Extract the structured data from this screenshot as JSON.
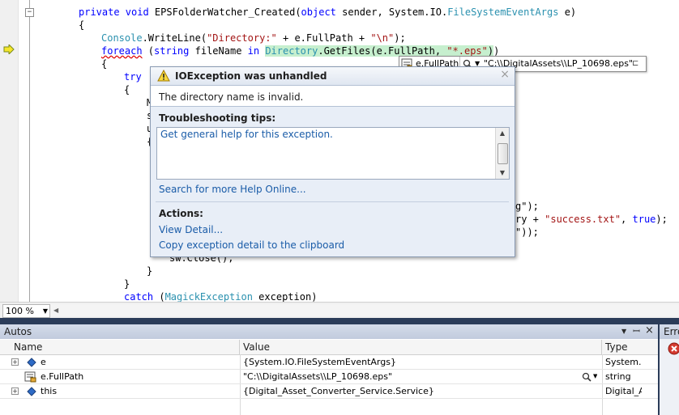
{
  "code": {
    "lines": [
      {
        "parts": [
          {
            "t": "private void ",
            "c": "kw"
          },
          {
            "t": "EPSFolderWatcher_Created(",
            "c": ""
          },
          {
            "t": "object",
            "c": "kw"
          },
          {
            "t": " sender, System.IO.",
            "c": ""
          },
          {
            "t": "FileSystemEventArgs",
            "c": "ty"
          },
          {
            "t": " e)",
            "c": ""
          }
        ]
      },
      {
        "parts": [
          {
            "t": "{",
            "c": ""
          }
        ]
      },
      {
        "parts": [
          {
            "t": "Console",
            "c": "ty"
          },
          {
            "t": ".WriteLine(",
            "c": ""
          },
          {
            "t": "\"Directory:\"",
            "c": "st"
          },
          {
            "t": " + e.FullPath + ",
            "c": ""
          },
          {
            "t": "\"\\n\"",
            "c": "st"
          },
          {
            "t": ");",
            "c": ""
          }
        ]
      },
      {
        "parts": [
          {
            "t": "foreach",
            "c": "kw squig"
          },
          {
            "t": " (",
            "c": ""
          },
          {
            "t": "string",
            "c": "kw"
          },
          {
            "t": " fileName ",
            "c": ""
          },
          {
            "t": "in",
            "c": "kw"
          },
          {
            "t": " ",
            "c": ""
          },
          {
            "t": "Directory",
            "c": "ty hl"
          },
          {
            "t": ".GetFiles(e.FullPath, ",
            "c": "hl"
          },
          {
            "t": "\"*.eps\"",
            "c": "st hl"
          },
          {
            "t": ")",
            "c": "hl"
          },
          {
            "t": ")",
            "c": ""
          }
        ]
      },
      {
        "parts": [
          {
            "t": "{",
            "c": ""
          }
        ]
      },
      {
        "parts": [
          {
            "t": "try",
            "c": "kw"
          }
        ]
      },
      {
        "parts": [
          {
            "t": "{",
            "c": ""
          }
        ]
      },
      {
        "parts": [
          {
            "t": "M",
            "c": ""
          }
        ]
      },
      {
        "parts": [
          {
            "t": "s",
            "c": ""
          }
        ]
      },
      {
        "parts": [
          {
            "t": "u",
            "c": ""
          }
        ]
      },
      {
        "parts": [
          {
            "t": "{",
            "c": ""
          }
        ]
      },
      {
        "parts": [
          {
            "t": "g\");",
            "c": ""
          }
        ]
      },
      {
        "parts": [
          {
            "t": "ry + ",
            "c": ""
          },
          {
            "t": "\"success.txt\"",
            "c": "st"
          },
          {
            "t": ", ",
            "c": ""
          },
          {
            "t": "true",
            "c": "kw"
          },
          {
            "t": ");",
            "c": ""
          }
        ]
      },
      {
        "parts": [
          {
            "t": "\"));",
            "c": ""
          }
        ]
      },
      {
        "parts": [
          {
            "t": "sw.Close();",
            "c": ""
          }
        ]
      },
      {
        "parts": [
          {
            "t": "}",
            "c": ""
          }
        ]
      },
      {
        "parts": [
          {
            "t": "}",
            "c": ""
          }
        ]
      },
      {
        "parts": [
          {
            "t": "catch",
            "c": "kw"
          },
          {
            "t": " (",
            "c": ""
          },
          {
            "t": "MagickException",
            "c": "ty"
          },
          {
            "t": " exception)",
            "c": ""
          }
        ]
      }
    ]
  },
  "datatip": {
    "name": "e.FullPath",
    "value": "\"C:\\\\DigitalAssets\\\\LP_10698.eps\""
  },
  "exception": {
    "title": "IOException was unhandled",
    "message": "The directory name is invalid.",
    "tips_title": "Troubleshooting tips:",
    "tip_link": "Get general help for this exception.",
    "search_link": "Search for more Help Online...",
    "actions_title": "Actions:",
    "action_view": "View Detail...",
    "action_copy": "Copy exception detail to the clipboard"
  },
  "zoom": {
    "value": "100 %"
  },
  "autos": {
    "title": "Autos",
    "columns": {
      "name": "Name",
      "value": "Value",
      "type": "Type"
    },
    "rows": [
      {
        "name": "e",
        "value": "{System.IO.FileSystemEventArgs}",
        "type": "System.I",
        "expandable": true
      },
      {
        "name": "e.FullPath",
        "value": "\"C:\\\\DigitalAssets\\\\LP_10698.eps\"",
        "type": "string",
        "expandable": false
      },
      {
        "name": "this",
        "value": "{Digital_Asset_Converter_Service.Service}",
        "type": "Digital_A",
        "expandable": true
      }
    ]
  },
  "errorlist": {
    "title": "Erro"
  }
}
